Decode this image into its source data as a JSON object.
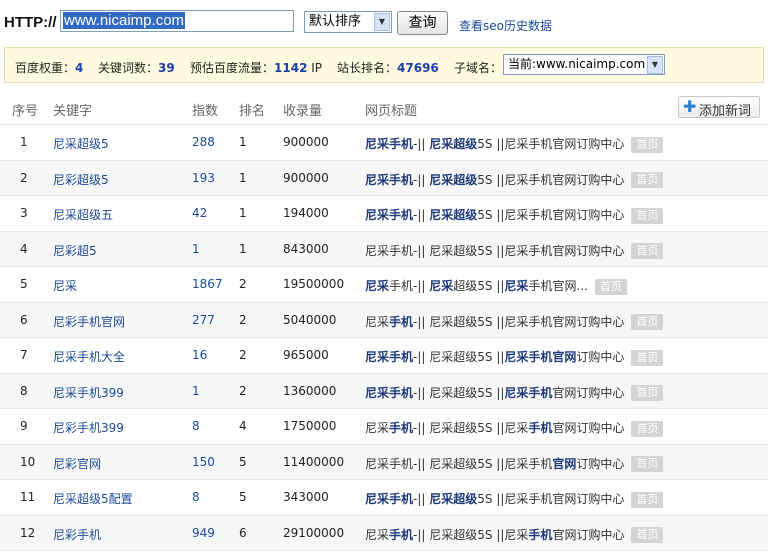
{
  "query": {
    "http_label": "HTTP://",
    "url": "www.nicaimp.com",
    "sort_selected": "默认排序",
    "query_button": "查询",
    "history_link": "查看seo历史数据"
  },
  "stats": {
    "weight_label": "百度权重：",
    "weight_value": "4",
    "keywords_label": "关键词数：",
    "keywords_value": "39",
    "traffic_label": "预估百度流量：",
    "traffic_value": "1142",
    "traffic_unit": "IP",
    "alexa_label": "站长排名：",
    "alexa_value": "47696",
    "subdomain_label": "子域名：",
    "subdomain_selected": "当前:www.nicaimp.com"
  },
  "table": {
    "headers": {
      "num": "序号",
      "keyword": "关键字",
      "index": "指数",
      "rank": "排名",
      "included": "收录量",
      "title": "网页标题"
    },
    "add_button": "添加新词",
    "home_badge": "首页",
    "rows": [
      {
        "num": "1",
        "keyword": "尼采超级5",
        "index": "288",
        "rank": "1",
        "included": "900000",
        "title": [
          {
            "t": "尼采手机",
            "b": true
          },
          {
            "t": "-|| ",
            "b": false
          },
          {
            "t": "尼采超级",
            "b": true
          },
          {
            "t": "5S ||尼采手机官网订购中心",
            "b": false
          }
        ]
      },
      {
        "num": "2",
        "keyword": "尼彩超级5",
        "index": "193",
        "rank": "1",
        "included": "900000",
        "title": [
          {
            "t": "尼采手机",
            "b": true
          },
          {
            "t": "-|| ",
            "b": false
          },
          {
            "t": "尼采超级",
            "b": true
          },
          {
            "t": "5S ||尼采手机官网订购中心",
            "b": false
          }
        ]
      },
      {
        "num": "3",
        "keyword": "尼采超级五",
        "index": "42",
        "rank": "1",
        "included": "194000",
        "title": [
          {
            "t": "尼采手机",
            "b": true
          },
          {
            "t": "-|| ",
            "b": false
          },
          {
            "t": "尼采超级",
            "b": true
          },
          {
            "t": "5S ||尼采手机官网订购中心",
            "b": false
          }
        ]
      },
      {
        "num": "4",
        "keyword": "尼彩超5",
        "index": "1",
        "rank": "1",
        "included": "843000",
        "title": [
          {
            "t": "尼采手机-|| 尼采超级5S ||尼采手机官网订购中心",
            "b": false
          }
        ]
      },
      {
        "num": "5",
        "keyword": "尼采",
        "index": "1867",
        "rank": "2",
        "included": "19500000",
        "title": [
          {
            "t": "尼采",
            "b": true
          },
          {
            "t": "手机-|| ",
            "b": false
          },
          {
            "t": "尼采",
            "b": true
          },
          {
            "t": "超级5S ||",
            "b": false
          },
          {
            "t": "尼采",
            "b": true
          },
          {
            "t": "手机官网...",
            "b": false
          }
        ]
      },
      {
        "num": "6",
        "keyword": "尼彩手机官网",
        "index": "277",
        "rank": "2",
        "included": "5040000",
        "title": [
          {
            "t": "尼采",
            "b": false
          },
          {
            "t": "手机",
            "b": true
          },
          {
            "t": "-|| 尼采超级5S ||尼采手机官网订购中心",
            "b": false
          }
        ]
      },
      {
        "num": "7",
        "keyword": "尼采手机大全",
        "index": "16",
        "rank": "2",
        "included": "965000",
        "title": [
          {
            "t": "尼采手机",
            "b": true
          },
          {
            "t": "-|| 尼采超级5S ||",
            "b": false
          },
          {
            "t": "尼采手机官网",
            "b": true
          },
          {
            "t": "订购中心",
            "b": false
          }
        ]
      },
      {
        "num": "8",
        "keyword": "尼采手机399",
        "index": "1",
        "rank": "2",
        "included": "1360000",
        "title": [
          {
            "t": "尼采手机",
            "b": true
          },
          {
            "t": "-|| 尼采超级5S ||",
            "b": false
          },
          {
            "t": "尼采手机",
            "b": true
          },
          {
            "t": "官网订购中心",
            "b": false
          }
        ]
      },
      {
        "num": "9",
        "keyword": "尼彩手机399",
        "index": "8",
        "rank": "4",
        "included": "1750000",
        "title": [
          {
            "t": "尼采",
            "b": false
          },
          {
            "t": "手机",
            "b": true
          },
          {
            "t": "-|| 尼采超级5S ||尼采",
            "b": false
          },
          {
            "t": "手机",
            "b": true
          },
          {
            "t": "官网订购中心",
            "b": false
          }
        ]
      },
      {
        "num": "10",
        "keyword": "尼彩官网",
        "index": "150",
        "rank": "5",
        "included": "11400000",
        "title": [
          {
            "t": "尼采手机-|| 尼采超级5S ||尼采手机",
            "b": false
          },
          {
            "t": "官网",
            "b": true
          },
          {
            "t": "订购中心",
            "b": false
          }
        ]
      },
      {
        "num": "11",
        "keyword": "尼采超级5配置",
        "index": "8",
        "rank": "5",
        "included": "343000",
        "title": [
          {
            "t": "尼采手机",
            "b": true
          },
          {
            "t": "-|| ",
            "b": false
          },
          {
            "t": "尼采超级",
            "b": true
          },
          {
            "t": "5S ||尼采手机官网订购中心",
            "b": false
          }
        ]
      },
      {
        "num": "12",
        "keyword": "尼彩手机",
        "index": "949",
        "rank": "6",
        "included": "29100000",
        "title": [
          {
            "t": "尼采",
            "b": false
          },
          {
            "t": "手机",
            "b": true
          },
          {
            "t": "-|| 尼采超级5S ||尼采",
            "b": false
          },
          {
            "t": "手机",
            "b": true
          },
          {
            "t": "官网订购中心",
            "b": false
          }
        ]
      }
    ]
  }
}
